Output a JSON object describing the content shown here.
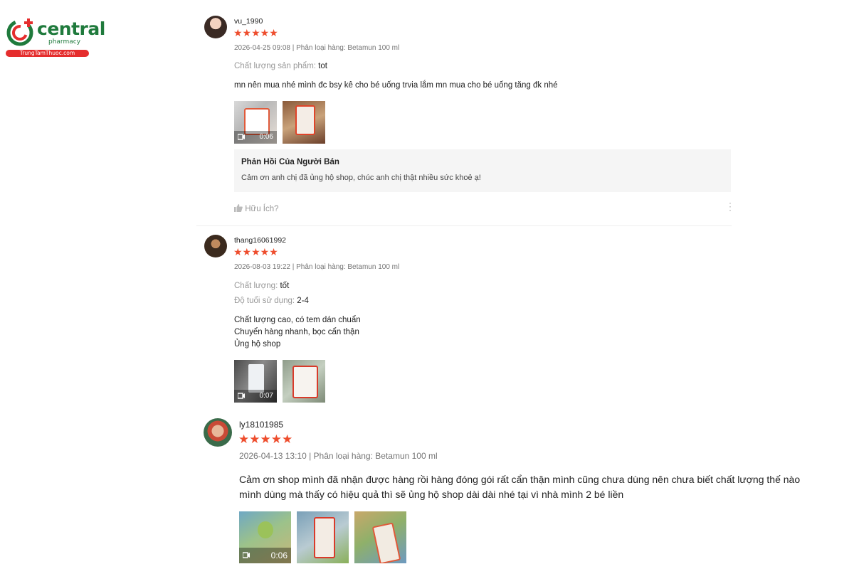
{
  "brand": {
    "name": "central",
    "sub": "pharmacy",
    "site": "TrungTamThuoc.com"
  },
  "reviews": [
    {
      "username": "vu_1990",
      "stars": "★★★★★",
      "meta": "2026-04-25 09:08 | Phân loại hàng: Betamun 100 ml",
      "attrs": [
        {
          "label": "Chất lượng sản phẩm:",
          "value": "tot"
        }
      ],
      "body": "mn nên mua nhé mình đc bsy kê cho bé uống trvia lắm mn mua cho bé uống tăng đk nhé",
      "video_duration": "0:06",
      "reply_title": "Phản Hồi Của Người Bán",
      "reply_text": "Cảm ơn anh chị đã ủng hộ shop, chúc anh chị thật nhiều sức khoẻ ạ!",
      "helpful": "Hữu Ích?"
    },
    {
      "username": "thang16061992",
      "stars": "★★★★★",
      "meta": "2026-08-03 19:22 | Phân loại hàng: Betamun 100 ml",
      "attrs": [
        {
          "label": "Chất lượng:",
          "value": "tốt"
        },
        {
          "label": "Độ tuổi sử dụng:",
          "value": "2-4"
        }
      ],
      "body": "Chất lượng cao, có tem dán chuẩn\nChuyển hàng nhanh, bọc cẩn thận\nỦng hộ shop",
      "video_duration": "0:07"
    },
    {
      "username": "ly18101985",
      "stars": "★★★★★",
      "meta": "2026-04-13 13:10 | Phân loại hàng: Betamun 100 ml",
      "body": "Cảm ơn shop mình đã nhận được hàng rồi hàng đóng gói rất cẩn thận mình cũng chưa dùng nên chưa biết chất lượng thế nào\nmình dùng mà thấy có hiệu quả thì sẽ ủng hộ shop dài dài nhé tại vì nhà mình 2 bé liền",
      "video_duration": "0:06"
    }
  ],
  "colors": {
    "star": "#ee4d2d",
    "brand_green": "#1f7a3c",
    "brand_red": "#e52d2d"
  }
}
